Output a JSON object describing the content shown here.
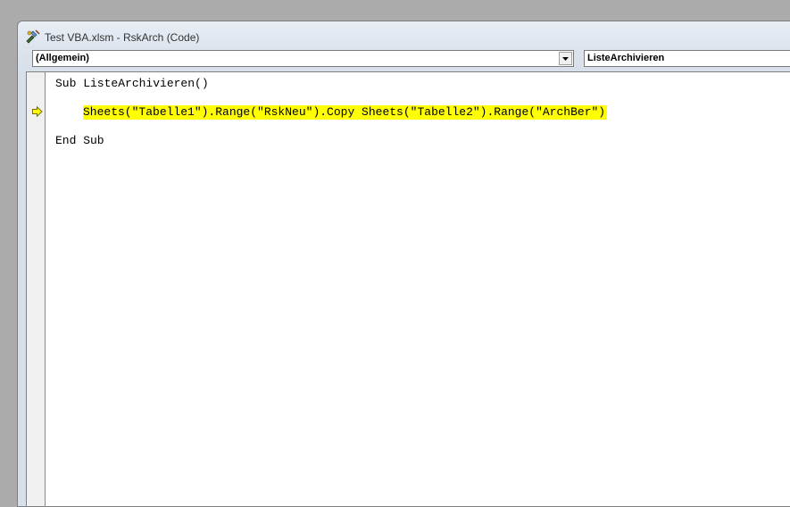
{
  "window": {
    "title": "Test VBA.xlsm - RskArch (Code)"
  },
  "toolbar": {
    "object_combo": {
      "value": "(Allgemein)"
    },
    "procedure_combo": {
      "value": "ListeArchivieren"
    }
  },
  "code": {
    "lines": [
      "Sub ListeArchivieren()",
      "Sheets(\"Tabelle1\").Range(\"RskNeu\").Copy Sheets(\"Tabelle2\").Range(\"ArchBer\")",
      "End Sub"
    ],
    "current_line_highlight": "#ffff00",
    "execution_arrow_color": "#ffff00"
  }
}
